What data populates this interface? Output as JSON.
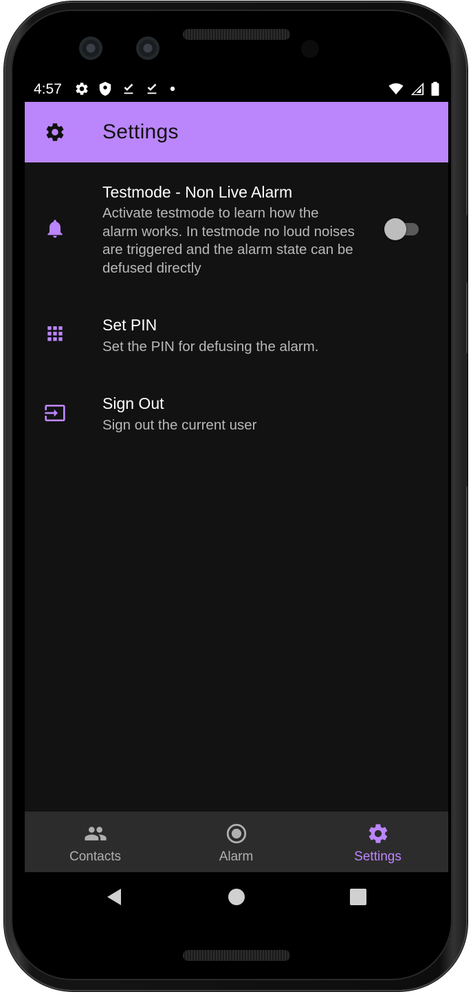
{
  "status_bar": {
    "time": "4:57",
    "left_icons": [
      "gear-icon",
      "shield-icon",
      "download-done-icon",
      "download-done-icon",
      "dot-icon"
    ],
    "right_icons": [
      "wifi-icon",
      "cell-signal-icon",
      "battery-icon"
    ]
  },
  "app_bar": {
    "icon": "gear-icon",
    "title": "Settings"
  },
  "settings": {
    "testmode": {
      "icon": "bell-icon",
      "title": "Testmode - Non Live Alarm",
      "description": "Activate testmode to learn how the alarm works. In testmode no loud noises are triggered and the alarm state can be defused directly",
      "enabled": false
    },
    "pin": {
      "icon": "dialpad-icon",
      "title": "Set PIN",
      "description": "Set the PIN for defusing the alarm."
    },
    "signout": {
      "icon": "login-icon",
      "title": "Sign Out",
      "description": "Sign out the current user"
    }
  },
  "bottom_nav": {
    "items": [
      {
        "label": "Contacts",
        "icon": "people-icon",
        "active": false
      },
      {
        "label": "Alarm",
        "icon": "radio-button-icon",
        "active": false
      },
      {
        "label": "Settings",
        "icon": "gear-icon",
        "active": true
      }
    ]
  },
  "system_nav": [
    "back-icon",
    "home-icon",
    "recents-icon"
  ],
  "colors": {
    "accent": "#bb86fc",
    "background": "#121212",
    "nav_background": "#2c2c2c",
    "text_primary": "#ffffff",
    "text_secondary": "#b8b8b8"
  }
}
